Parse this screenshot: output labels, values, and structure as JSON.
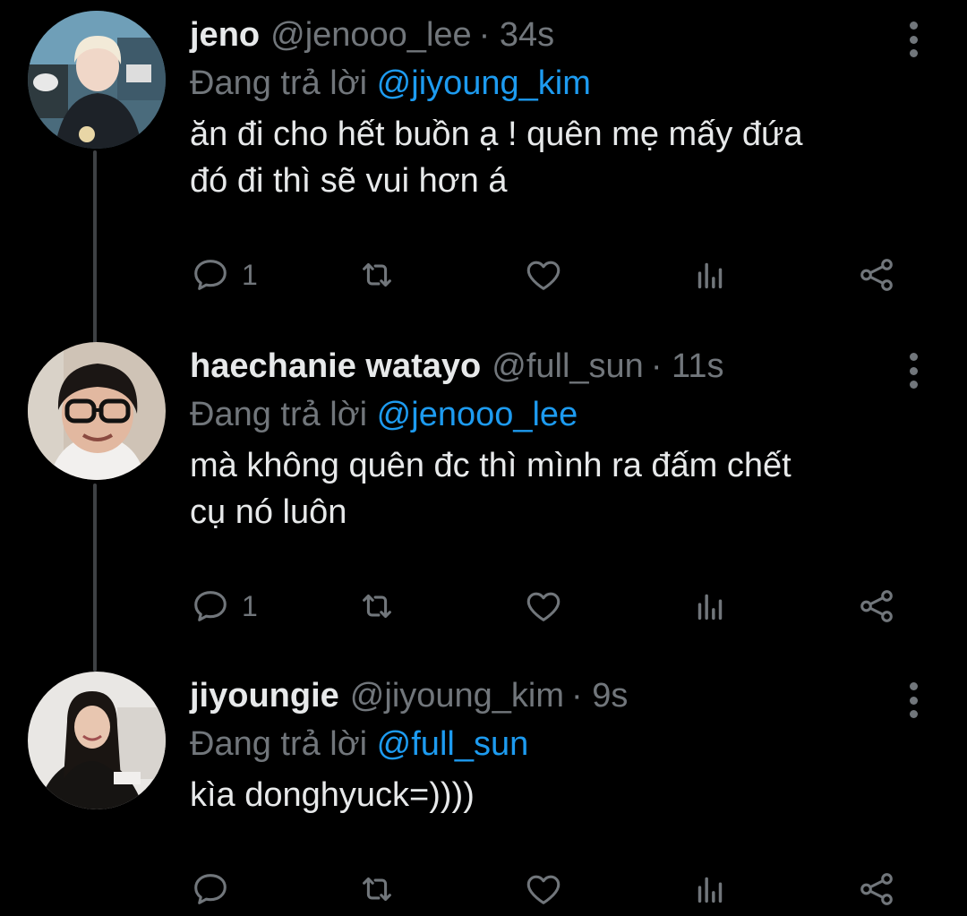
{
  "colors": {
    "background": "#000000",
    "primary_text": "#e7e9ea",
    "secondary_text": "#71767b",
    "mention": "#1d9bf0",
    "thread_line": "#3e4144"
  },
  "tweets": [
    {
      "display_name": "jeno",
      "handle": "@jenooo_lee",
      "time": "· 34s",
      "reply_prefix": "Đang trả lời",
      "reply_to": "@jiyoung_kim",
      "text": "ăn đi cho hết buồn ạ ! quên mẹ mấy đứa\nđó đi thì sẽ vui hơn á",
      "reply_count": "1",
      "retweet_count": "",
      "like_count": ""
    },
    {
      "display_name": "haechanie watayo",
      "handle": "@full_sun",
      "time": "· 11s",
      "reply_prefix": "Đang trả lời",
      "reply_to": "@jenooo_lee",
      "text": "mà không quên đc thì mình ra đấm chết\ncụ nó luôn",
      "reply_count": "1",
      "retweet_count": "",
      "like_count": ""
    },
    {
      "display_name": "jiyoungie",
      "handle": "@jiyoung_kim",
      "time": "· 9s",
      "reply_prefix": "Đang trả lời",
      "reply_to": "@full_sun",
      "text": "kìa donghyuck=))))",
      "reply_count": "",
      "retweet_count": "",
      "like_count": ""
    }
  ],
  "icons": {
    "reply": "reply-icon",
    "retweet": "retweet-icon",
    "like": "heart-icon",
    "analytics": "analytics-icon",
    "share": "share-icon",
    "more": "more-vertical-icon"
  }
}
